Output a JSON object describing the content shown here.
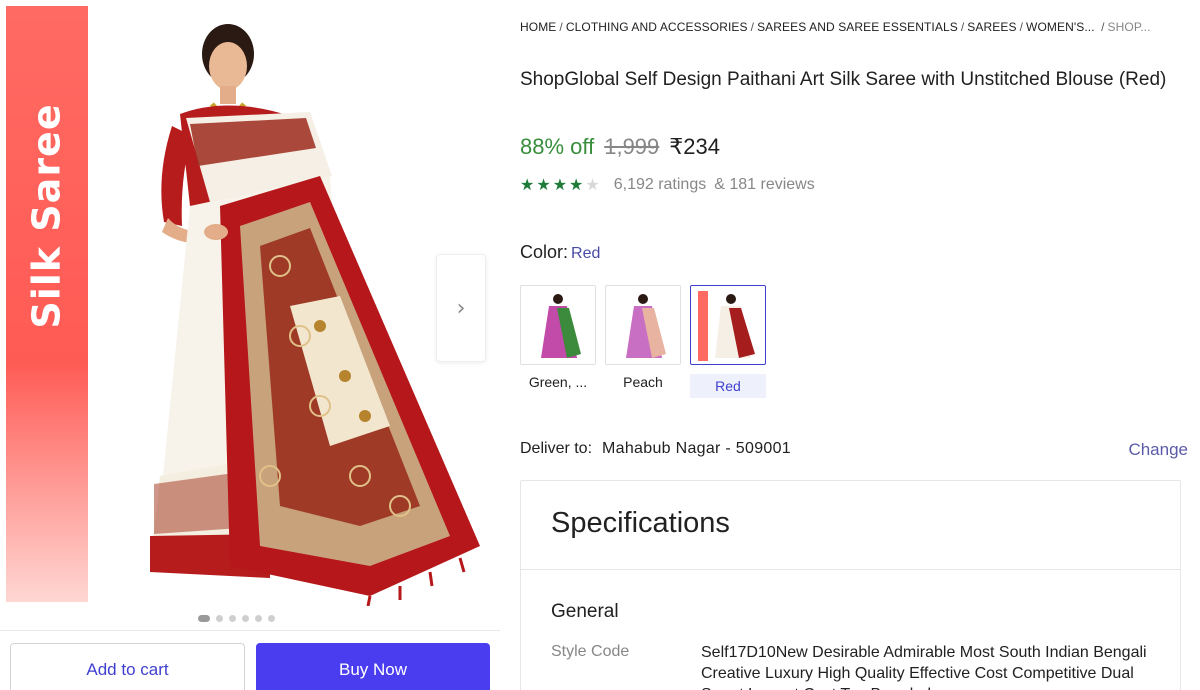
{
  "gallery": {
    "banner_text": "Silk Saree",
    "dots_count": 6,
    "active_dot": 0,
    "next_icon": "›"
  },
  "actions": {
    "add_to_cart": "Add to cart",
    "buy_now": "Buy Now"
  },
  "breadcrumb": [
    "HOME",
    "CLOTHING AND ACCESSORIES",
    "SAREES AND SAREE ESSENTIALS",
    "SAREES",
    "WOMEN'S...",
    "SHOP..."
  ],
  "product": {
    "title": "ShopGlobal Self Design Paithani Art Silk Saree with Unstitched Blouse (Red)",
    "discount": "88% off",
    "mrp": "1,999",
    "price": "₹234",
    "rating_stars": 4,
    "ratings": "6,192 ratings",
    "reviews": "& 181 reviews"
  },
  "color": {
    "label": "Color:",
    "selected": "Red",
    "options": [
      {
        "label": "Green, ...",
        "accent": "#c24aa8"
      },
      {
        "label": "Peach",
        "accent": "#c86fc4"
      },
      {
        "label": "Red",
        "accent": "#a51d1d"
      }
    ]
  },
  "delivery": {
    "label": "Deliver to:",
    "location": "Mahabub Nagar - 509001",
    "change": "Change"
  },
  "specifications": {
    "title": "Specifications",
    "group": "General",
    "key": "Style Code",
    "value": "Self17D10New Desirable Admirable Most South Indian Bengali Creative Luxury High Quality Effective Cost Competitive Dual Smart Lowest Cost Top Branded"
  },
  "colors": {
    "accent": "#4a3df0",
    "link": "#5a5aa8",
    "discount_green": "#388e3c",
    "star_green": "#1e7b3a",
    "banner_red": "#ff5b55"
  }
}
